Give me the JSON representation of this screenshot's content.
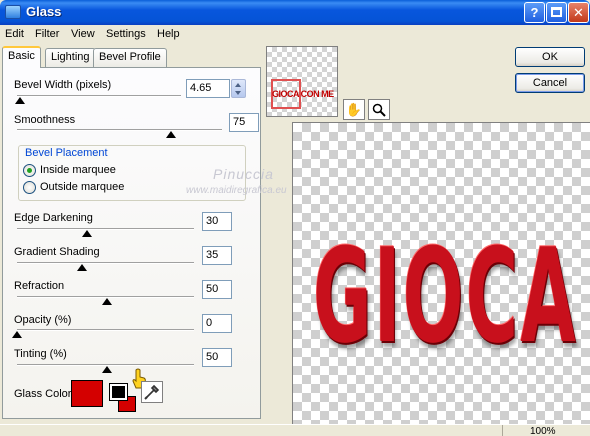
{
  "window": {
    "title": "Glass"
  },
  "menu": [
    "Edit",
    "Filter",
    "View",
    "Settings",
    "Help"
  ],
  "tabs": [
    "Basic",
    "Lighting",
    "Bevel Profile"
  ],
  "controls": {
    "bevel_width": {
      "label": "Bevel Width (pixels)",
      "value": "4.65",
      "level": 0.02
    },
    "smoothness": {
      "label": "Smoothness",
      "value": "75",
      "level": 0.75
    },
    "edge_darkening": {
      "label": "Edge Darkening",
      "value": "30",
      "level": 0.3
    },
    "gradient_shading": {
      "label": "Gradient Shading",
      "value": "35",
      "level": 0.35
    },
    "refraction": {
      "label": "Refraction",
      "value": "50",
      "level": 0.5
    },
    "opacity": {
      "label": "Opacity (%)",
      "value": "0",
      "level": 0.0
    },
    "tinting": {
      "label": "Tinting (%)",
      "value": "50",
      "level": 0.5
    }
  },
  "bevel_placement": {
    "title": "Bevel Placement",
    "options": [
      "Inside marquee",
      "Outside marquee"
    ],
    "selected": "Inside marquee"
  },
  "glass_color": {
    "label": "Glass Color",
    "color": "#d40000"
  },
  "buttons": {
    "ok": "OK",
    "cancel": "Cancel"
  },
  "watermark": {
    "name": "Pinuccia",
    "url": "www.maidiregrafica.eu"
  },
  "preview": {
    "thumb_text": "GIOCA CON ME",
    "big_text": "GIOCA C",
    "color": "#c8101c"
  },
  "status": {
    "zoom": "100%"
  },
  "icons": [
    "pan-hand-icon",
    "zoom-magnifier-icon",
    "eyedropper-icon",
    "help-icon",
    "maximize-icon",
    "close-icon"
  ]
}
